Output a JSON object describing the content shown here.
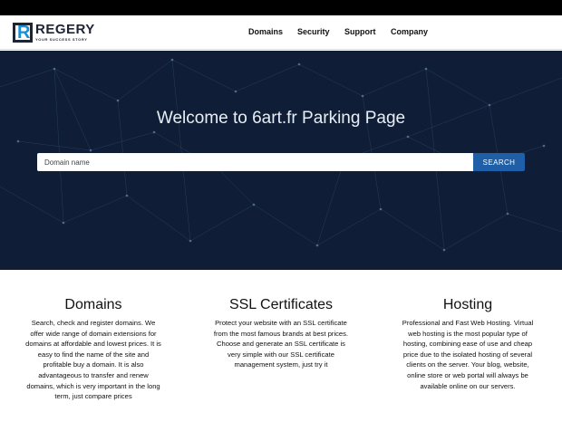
{
  "brand": {
    "name": "REGERY",
    "tagline": "YOUR SUCCESS STORY"
  },
  "nav": [
    {
      "label": "Domains"
    },
    {
      "label": "Security"
    },
    {
      "label": "Support"
    },
    {
      "label": "Company"
    }
  ],
  "hero": {
    "title": "Welcome to 6art.fr Parking Page",
    "search_placeholder": "Domain name",
    "search_button": "SEARCH"
  },
  "features": [
    {
      "title": "Domains",
      "text": "Search, check and register domains. We offer wide range of domain extensions for domains at affordable and lowest prices. It is easy to find the name of the site and profitable buy a domain. It is also advantageous to transfer and renew domains, which is very important in the long term, just compare prices"
    },
    {
      "title": "SSL Certificates",
      "text": "Protect your website with an SSL certificate from the most famous brands at best prices. Choose and generate an SSL certificate is very simple with our SSL certificate management system, just try it"
    },
    {
      "title": "Hosting",
      "text": "Professional and Fast Web Hosting. Virtual web hosting is the most popular type of hosting, combining ease of use and cheap price due to the isolated hosting of several clients on the server. Your blog, website, online store or web portal will always be available online on our servers."
    }
  ],
  "colors": {
    "hero_bg": "#0f1e36",
    "button": "#1e5fa8",
    "brand_accent": "#1a8fd6"
  }
}
